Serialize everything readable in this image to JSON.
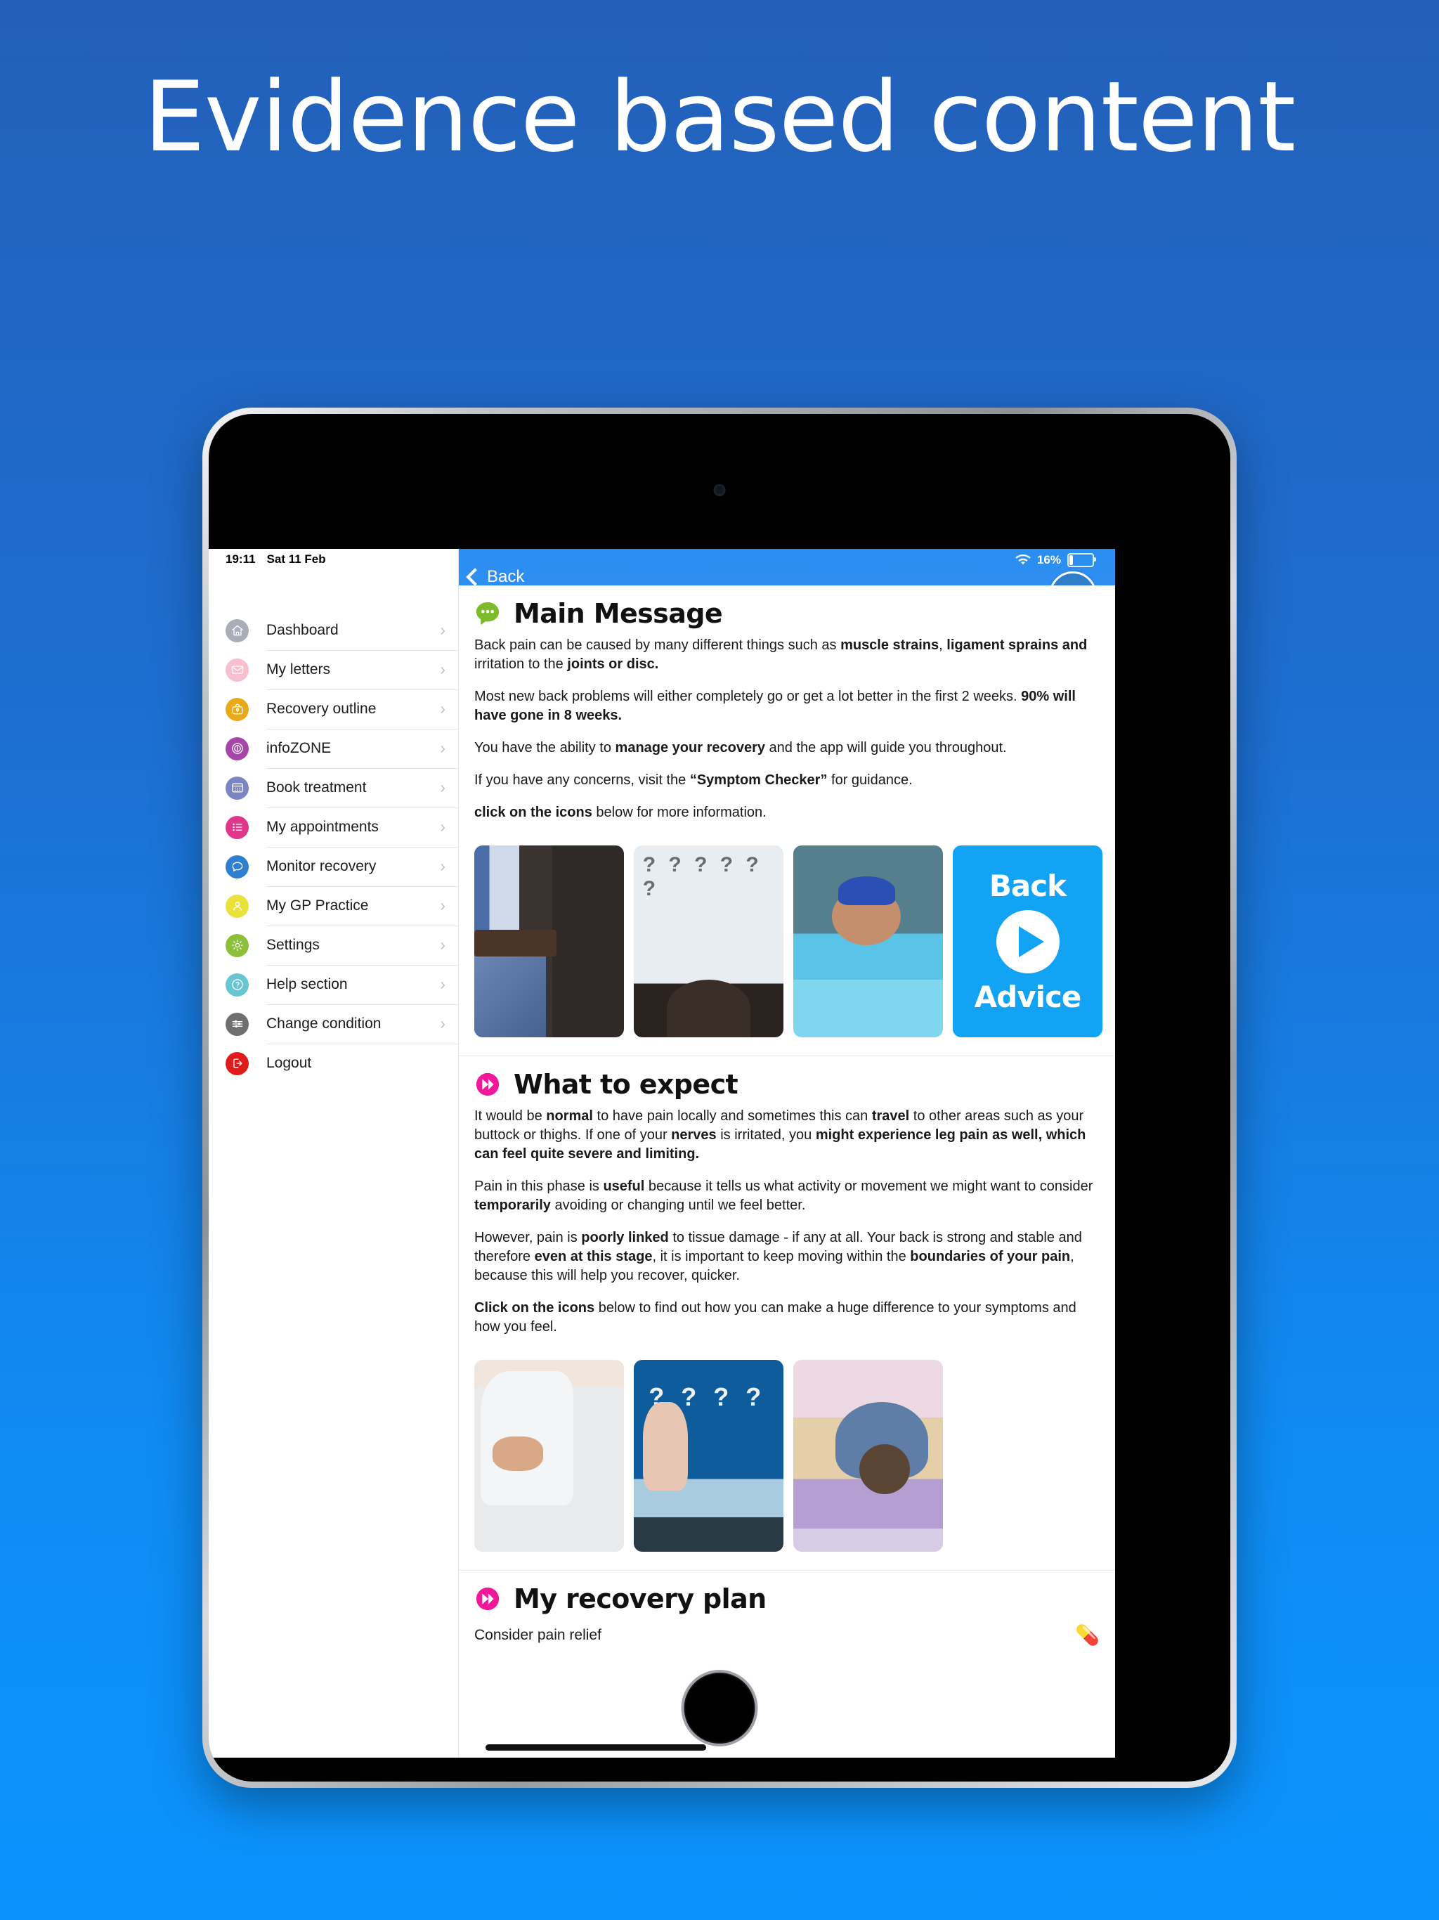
{
  "hero": {
    "headline": "Evidence based content"
  },
  "device": {
    "status_time": "19:11",
    "status_date": "Sat 11 Feb",
    "battery_percent": "16%"
  },
  "sidebar": {
    "items": [
      {
        "label": "Dashboard",
        "icon": "home-icon",
        "color": "#a9adb8",
        "chevron": "›"
      },
      {
        "label": "My letters",
        "icon": "envelope-icon",
        "color": "#f7bfd0",
        "chevron": "›"
      },
      {
        "label": "Recovery outline",
        "icon": "briefcase-icon",
        "color": "#eaa919",
        "chevron": "›"
      },
      {
        "label": "infoZONE",
        "icon": "info-icon",
        "color": "#a845a8",
        "chevron": "›"
      },
      {
        "label": "Book treatment",
        "icon": "calendar-icon",
        "color": "#7b85c4",
        "chevron": "›"
      },
      {
        "label": "My appointments",
        "icon": "list-icon",
        "color": "#e0368c",
        "chevron": "›"
      },
      {
        "label": "Monitor recovery",
        "icon": "chat-icon",
        "color": "#2f7fd0",
        "chevron": "›"
      },
      {
        "label": "My GP Practice",
        "icon": "person-icon",
        "color": "#eae23a",
        "chevron": "›"
      },
      {
        "label": "Settings",
        "icon": "gear-icon",
        "color": "#8cc03a",
        "chevron": "›"
      },
      {
        "label": "Help section",
        "icon": "question-icon",
        "color": "#67c6cf",
        "chevron": "›"
      },
      {
        "label": "Change condition",
        "icon": "sliders-icon",
        "color": "#6f6f6f",
        "chevron": "›"
      },
      {
        "label": "Logout",
        "icon": "logout-icon",
        "color": "#e01b1b",
        "chevron": ""
      }
    ]
  },
  "topbar": {
    "back_label": "Back"
  },
  "main_message": {
    "title": "Main Message",
    "icon": "chat-bubble-icon",
    "icon_color": "#7dbb2a",
    "paragraphs": [
      "Back pain can be caused by many different things such as <b>muscle strains</b>, <b>ligament sprains and</b> irritation to the <b>joints or disc.</b>",
      "Most new back problems will either completely go or get a lot better in the first 2 weeks. <b>90% will have gone in 8 weeks.</b>",
      "You have the ability to <b>manage your recovery</b> and the app will guide you throughout.",
      "If you have any concerns, visit the <b>“Symptom Checker”</b> for guidance.",
      "<b>click on the icons</b> below for more information."
    ],
    "thumbnails": [
      {
        "name": "man-holding-lower-back-photo",
        "style": "th-belt"
      },
      {
        "name": "woman-with-question-marks-photo",
        "style": "th-q-dark"
      },
      {
        "name": "woman-swimming-in-pool-photo",
        "style": "th-swim"
      },
      {
        "name": "back-advice-video-tile",
        "style": "th-backadv",
        "line1": "Back",
        "line2": "Advice"
      }
    ]
  },
  "what_to_expect": {
    "title": "What to expect",
    "icon": "fast-forward-icon",
    "icon_color": "#f2189a",
    "paragraphs": [
      "It would be <b>normal</b> to have pain locally and sometimes this can <b>travel</b> to other areas such as your buttock or thighs. If one of your <b>nerves</b> is irritated, you <b>might experience leg pain as well, which can feel quite severe and limiting.</b>",
      "Pain in this phase is <b>useful</b> because it tells us what activity or movement we might want to consider <b>temporarily</b> avoiding or changing until we feel better.",
      "However, pain is <b>poorly linked</b> to tissue damage - if any at all. Your back is strong and stable and therefore <b>even at this stage</b>, it is important to keep moving within the <b>boundaries of your pain</b>, because this will help you recover, quicker.",
      "<b>Click on the icons</b> below to find out how you can make a huge difference to your symptoms and how you feel."
    ],
    "thumbnails": [
      {
        "name": "woman-with-lower-back-pain-photo",
        "style": "th-lowback"
      },
      {
        "name": "finger-on-tablet-questions-photo",
        "style": "th-tablet"
      },
      {
        "name": "yoga-childs-pose-photo",
        "style": "th-yoga"
      }
    ]
  },
  "recovery_plan": {
    "title": "My recovery plan",
    "icon": "fast-forward-icon",
    "icon_color": "#f2189a",
    "rows": [
      {
        "label": "Consider pain relief",
        "emoji": "💊"
      }
    ]
  }
}
